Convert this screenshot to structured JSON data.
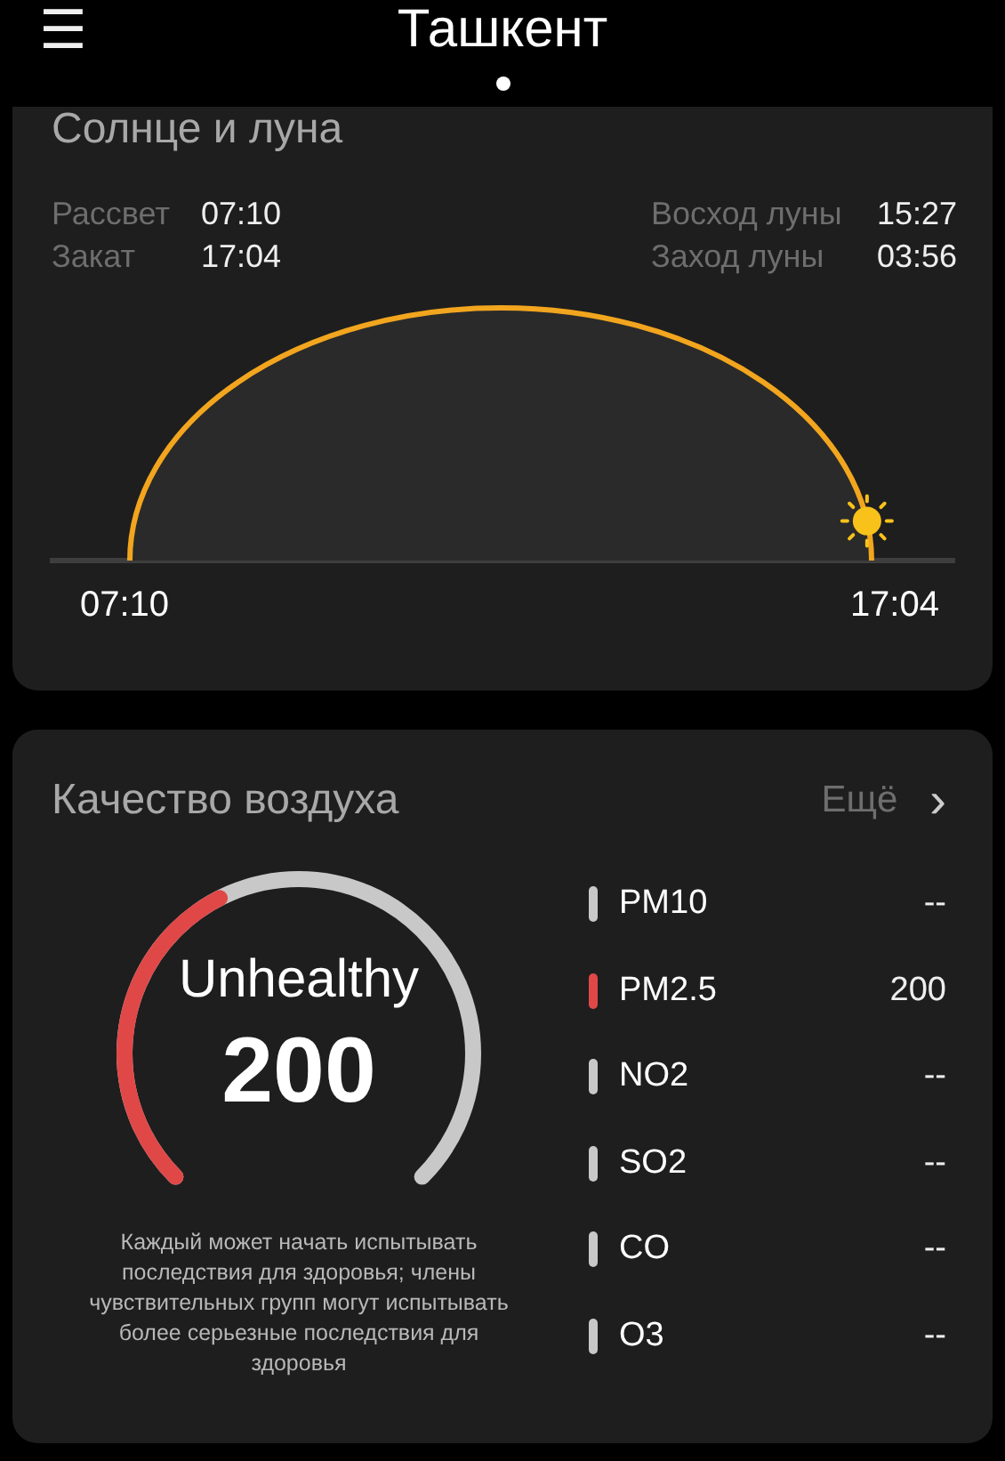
{
  "header": {
    "menu": "☰",
    "city": "Ташкент",
    "page_dots": [
      {
        "selected": true
      }
    ]
  },
  "sun_moon": {
    "title": "Солнце и луна",
    "left": [
      {
        "label": "Рассвет",
        "value": "07:10"
      },
      {
        "label": "Закат",
        "value": "17:04"
      }
    ],
    "right": [
      {
        "label": "Восход луны",
        "value": "15:27"
      },
      {
        "label": "Заход луны",
        "value": "03:56"
      }
    ],
    "start": "07:10",
    "end": "17:04"
  },
  "air": {
    "title": "Качество воздуха",
    "more": "Ещё",
    "more_arrow": "›",
    "status": "Unhealthy",
    "index": "200",
    "description": "Каждый может начать испытывать последствия для здоровья; члены чувствительных групп могут испытывать более серьезные последствия для здоровья",
    "pollutants": [
      {
        "name": "PM10",
        "value": "--",
        "color": "#c8c8c8"
      },
      {
        "name": "PM2.5",
        "value": "200",
        "color": "#e04848"
      },
      {
        "name": "NO2",
        "value": "--",
        "color": "#c8c8c8"
      },
      {
        "name": "SO2",
        "value": "--",
        "color": "#c8c8c8"
      },
      {
        "name": "CO",
        "value": "--",
        "color": "#c8c8c8"
      },
      {
        "name": "O3",
        "value": "--",
        "color": "#c8c8c8"
      }
    ]
  }
}
